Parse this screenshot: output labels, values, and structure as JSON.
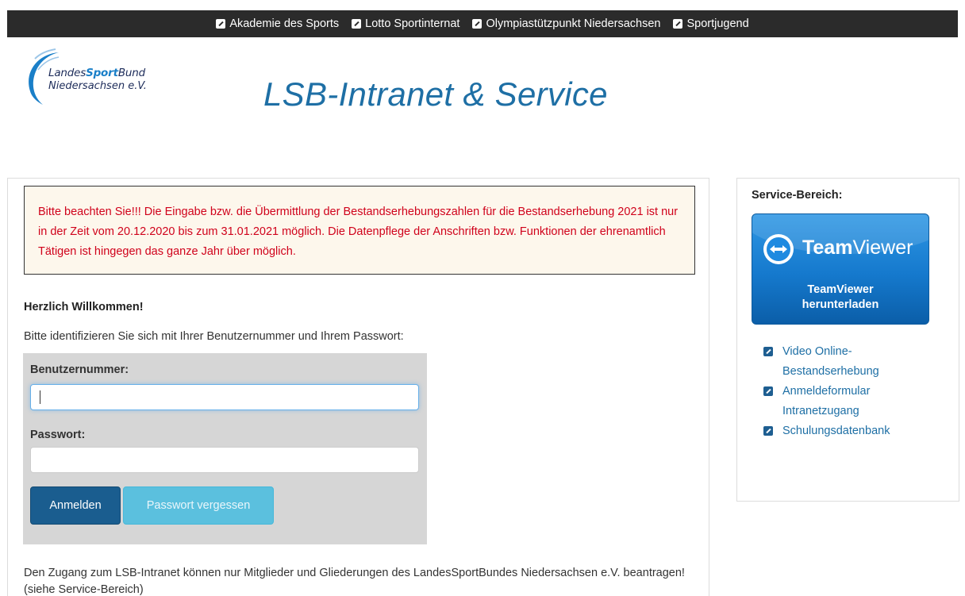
{
  "topnav": {
    "links": [
      "Akademie des Sports",
      "Lotto Sportinternat",
      "Olympiastützpunkt Niedersachsen",
      "Sportjugend"
    ]
  },
  "logo": {
    "line1_a": "Landes",
    "line1_b": "Sport",
    "line1_c": "Bund",
    "line2": "Niedersachsen e.V."
  },
  "header": {
    "title": "LSB-Intranet & Service"
  },
  "notice": {
    "text": "Bitte beachten Sie!!! Die Eingabe bzw. die Übermittlung der Bestandserhebungszahlen für die Bestandserhebung 2021 ist nur in der Zeit vom 20.12.2020 bis zum 31.01.2021 möglich. Die Datenpflege der Anschriften bzw. Funktionen der ehrenamtlich Tätigen ist hingegen das ganze Jahr über möglich."
  },
  "main": {
    "welcome": "Herzlich Willkommen!",
    "intro": "Bitte identifizieren Sie sich mit Ihrer Benutzernummer und Ihrem Passwort:",
    "footer": "Den Zugang zum LSB-Intranet können nur Mitglieder und Gliederungen des LandesSportBundes Niedersachsen e.V. beantragen! (siehe Service-Bereich)"
  },
  "login": {
    "user_label": "Benutzernummer:",
    "user_value": "",
    "pass_label": "Passwort:",
    "pass_value": "",
    "login_button": "Anmelden",
    "forgot_button": "Passwort vergessen"
  },
  "sidebar": {
    "title": "Service-Bereich:",
    "teamviewer": {
      "brand_bold": "Team",
      "brand_rest": "Viewer",
      "cta_line1": "TeamViewer",
      "cta_line2": "herunterladen"
    },
    "links": [
      "Video Online-Bestandserhebung",
      "Anmeldeformular Intranetzugang",
      "Schulungsdatenbank"
    ]
  },
  "colors": {
    "topbar_bg": "#2b2b2b",
    "title_blue": "#1e6fa5",
    "notice_red": "#d0021b",
    "notice_bg": "#fdf7ec",
    "login_button": "#1a5d8f",
    "forgot_button": "#5bc0de"
  },
  "icons": {
    "external_link": "external-link-icon",
    "teamviewer": "teamviewer-logo-icon"
  }
}
